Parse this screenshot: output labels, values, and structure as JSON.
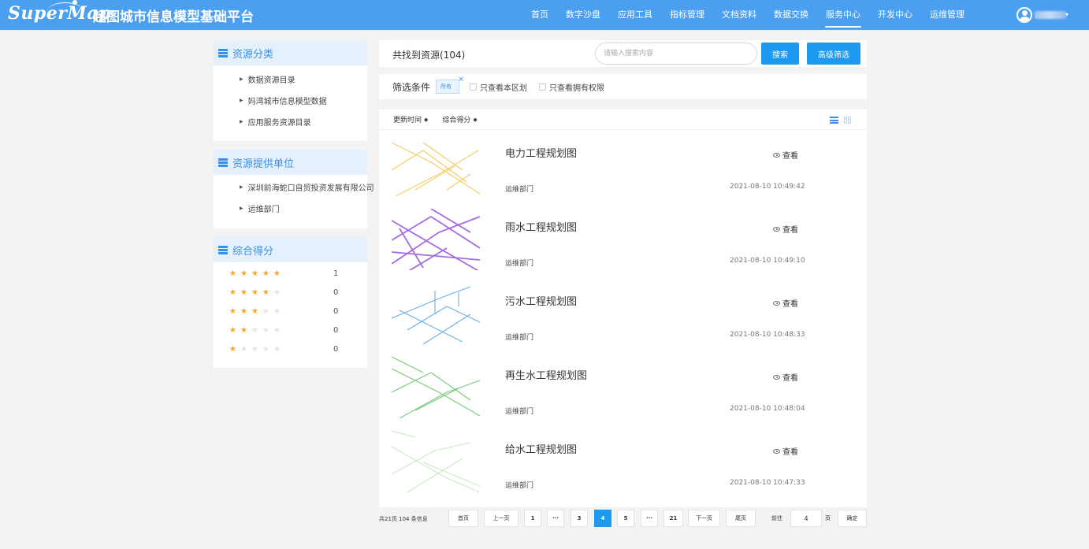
{
  "header": {
    "logo": "SuperMap",
    "title": "超图城市信息模型基础平台",
    "nav": [
      "首页",
      "数字沙盘",
      "应用工具",
      "指标管理",
      "文档资料",
      "数据交换",
      "服务中心",
      "开发中心",
      "运维管理"
    ],
    "active_nav": "服务中心"
  },
  "sidebar": {
    "category": {
      "title": "资源分类",
      "items": [
        "数据资源目录",
        "妈湾城市信息模型数据",
        "应用服务资源目录"
      ]
    },
    "provider": {
      "title": "资源提供单位",
      "items": [
        "深圳前海蛇口自贸投资发展有限公司",
        "运维部门"
      ]
    },
    "score": {
      "title": "综合得分",
      "rows": [
        {
          "stars": 5,
          "count": "1"
        },
        {
          "stars": 4,
          "count": "0"
        },
        {
          "stars": 3,
          "count": "0"
        },
        {
          "stars": 2,
          "count": "0"
        },
        {
          "stars": 1,
          "count": "0"
        }
      ]
    }
  },
  "search": {
    "result_text": "共找到资源(104)",
    "placeholder": "请输入搜索内容",
    "search_label": "搜索",
    "advanced_label": "高级筛选"
  },
  "filter": {
    "label": "筛选条件",
    "tag": "所有",
    "tag_close": "×",
    "options": [
      "只查看本区划",
      "只查看拥有权限"
    ]
  },
  "sort": {
    "items": [
      "更新时间",
      "综合得分"
    ],
    "arrow": "◆"
  },
  "results": [
    {
      "name": "电力工程规划图",
      "dept": "运维部门",
      "time": "2021-08-10 10:49:42",
      "view_label": "查看",
      "thumb_color": "#f2cf6b"
    },
    {
      "name": "雨水工程规划图",
      "dept": "运维部门",
      "time": "2021-08-10 10:49:10",
      "view_label": "查看",
      "thumb_color": "#a56ce0"
    },
    {
      "name": "污水工程规划图",
      "dept": "运维部门",
      "time": "2021-08-10 10:48:33",
      "view_label": "查看",
      "thumb_color": "#6aaee8"
    },
    {
      "name": "再生水工程规划图",
      "dept": "运维部门",
      "time": "2021-08-10 10:48:04",
      "view_label": "查看",
      "thumb_color": "#79c979"
    },
    {
      "name": "给水工程规划图",
      "dept": "运维部门",
      "time": "2021-08-10 10:47:33",
      "view_label": "查看",
      "thumb_color": "#b8e3b0"
    }
  ],
  "pagination": {
    "total_text": "共21页 104 条信息",
    "first": "首页",
    "prev": "上一页",
    "pages": [
      "1",
      "···",
      "3",
      "4",
      "5",
      "···",
      "21"
    ],
    "current": "4",
    "next": "下一页",
    "last": "尾页",
    "goto_label": "前往",
    "goto_value": "4",
    "page_unit": "页",
    "confirm": "确定"
  },
  "colors": {
    "header_bg": "#4a9ff0",
    "accent": "#1c9af1",
    "panel_head_bg": "#e4f1fd",
    "star": "#f5a623"
  }
}
